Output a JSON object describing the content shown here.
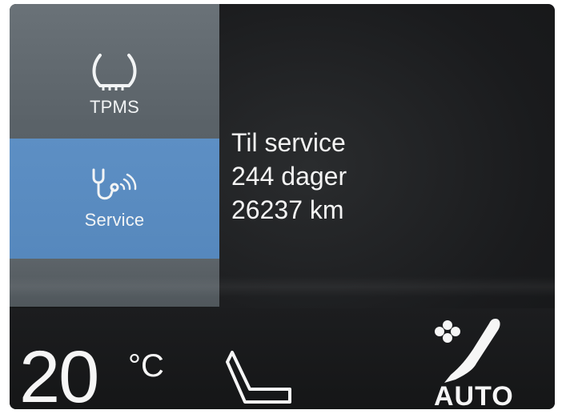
{
  "sidebar": {
    "items": [
      {
        "label": "TPMS",
        "icon": "tire-pressure-icon",
        "selected": false
      },
      {
        "label": "Service",
        "icon": "stethoscope-icon",
        "selected": true
      }
    ]
  },
  "service_info": {
    "line1": "Til service",
    "line2": "244 dager",
    "line3": "26237 km"
  },
  "climate_bar": {
    "temperature": "20",
    "unit": "°C",
    "seat_icon": "seat-heating-icon",
    "fan_icon": "fan-airflow-icon",
    "mode": "AUTO"
  },
  "colors": {
    "sidebar_bg": "#5a6268",
    "selected_bg": "#5d8fc4",
    "screen_bg": "#1a1b1d",
    "text": "#f4f4f4"
  }
}
